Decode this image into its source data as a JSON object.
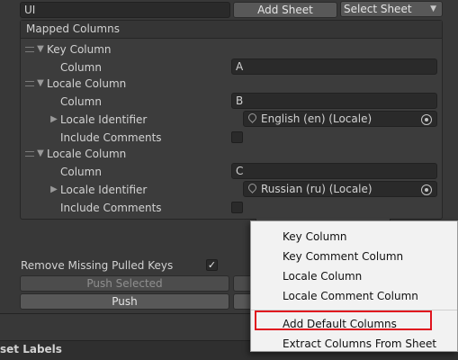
{
  "top": {
    "name_value": "UI",
    "add_sheet": "Add Sheet",
    "select_sheet": "Select Sheet"
  },
  "mapped_columns": {
    "header": "Mapped Columns",
    "key_column": {
      "title": "Key Column",
      "column_label": "Column",
      "column_value": "A"
    },
    "locale_columns": [
      {
        "title": "Locale Column",
        "column_label": "Column",
        "column_value": "B",
        "locale_identifier_label": "Locale Identifier",
        "locale_identifier_value": "English (en) (Locale)",
        "include_comments_label": "Include Comments",
        "include_comments_checked": false
      },
      {
        "title": "Locale Column",
        "column_label": "Column",
        "column_value": "C",
        "locale_identifier_label": "Locale Identifier",
        "locale_identifier_value": "Russian (ru) (Locale)",
        "include_comments_label": "Include Comments",
        "include_comments_checked": false
      }
    ]
  },
  "options": {
    "remove_missing_label": "Remove Missing Pulled Keys",
    "remove_missing_check": "✓",
    "push_selected": "Push Selected",
    "push": "Push"
  },
  "bottom": {
    "section_label": "set Labels"
  },
  "context_menu": {
    "items": [
      "Key Column",
      "Key Comment Column",
      "Locale Column",
      "Locale Comment Column",
      "Add Default Columns",
      "Extract Columns From Sheet"
    ]
  },
  "icons": {
    "dropdown": "chevron-down-icon",
    "expand": "triangle-down-icon",
    "collapse": "triangle-right-icon",
    "locale": "pin-icon",
    "picker": "object-picker-icon"
  },
  "colors": {
    "highlight": "#e0141e",
    "panel_bg": "#383838",
    "menu_bg": "#f2f2f2"
  }
}
